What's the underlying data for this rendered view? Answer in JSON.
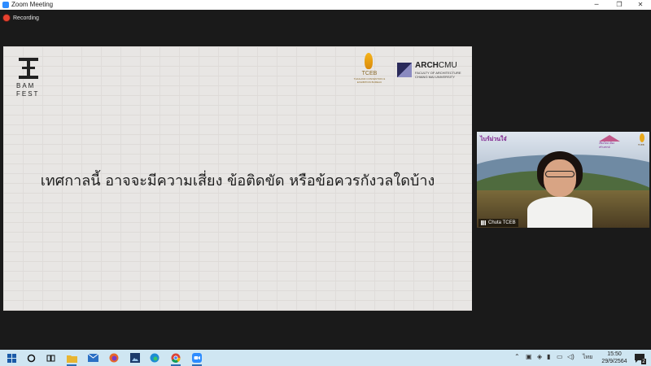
{
  "window": {
    "title": "Zoom Meeting",
    "controls": [
      "minimize",
      "maximize",
      "close"
    ]
  },
  "recording": {
    "label": "Recording",
    "icon": "record-dot-icon"
  },
  "slide": {
    "logo_bam_line1": "BAM",
    "logo_bam_line2": "FEST",
    "logo_tceb": "TCEB",
    "logo_tceb_sub": "THAILAND CONVENTION & EXHIBITION BUREAU",
    "logo_arch_bold": "ARCH",
    "logo_arch_light": "CMU",
    "logo_arch_faculty": "FACULTY OF ARCHITECTURE",
    "logo_arch_university": "CHIANG MAI UNIVERSITY",
    "headline": "เทศกาลนี้ อาจจะมีความเสี่ยง ข้อติดขัด หรือข้อควรกังวลใดบ้าง",
    "background_color": "#e8e6e4"
  },
  "video_tile": {
    "participant_name": "Chuta TCEB",
    "logo_left": "ไบร์ม่วนใจ๋",
    "logo_right_text": "เชียงใหม่ เมืองสร้างสรรค์",
    "logo_tceb_text": "TCEB"
  },
  "taskbar": {
    "icons": [
      "windows-start-icon",
      "search-circle-icon",
      "task-view-icon",
      "file-explorer-icon",
      "mail-icon",
      "firefox-icon",
      "photos-icon",
      "edge-icon",
      "chrome-icon",
      "zoom-icon"
    ],
    "tray_icons": [
      "chevron-up-icon",
      "teams-icon",
      "dropbox-icon",
      "usb-icon",
      "network-icon",
      "speaker-icon"
    ],
    "language": "ไทย",
    "time": "15:50",
    "date": "29/9/2564",
    "notifications_count": "2"
  }
}
